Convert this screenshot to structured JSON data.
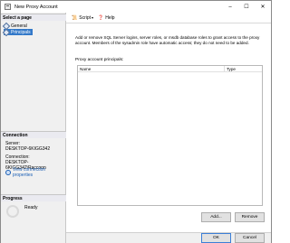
{
  "window": {
    "title": "New Proxy Account",
    "controls": [
      "–",
      "☐",
      "✕"
    ]
  },
  "left": {
    "select_page_header": "Select a page",
    "pages": [
      {
        "label": "General",
        "selected": false
      },
      {
        "label": "Principals",
        "selected": true
      }
    ],
    "connection_header": "Connection",
    "server_label": "Server:",
    "server_value": "DESKTOP-6KIGG342",
    "connection_label": "Connection:",
    "connection_value": "DESKTOP-6KIGG342\\Raccoon",
    "view_properties_link": "View connection properties",
    "progress_header": "Progress",
    "progress_status": "Ready"
  },
  "toolbar": {
    "script_label": "Script",
    "help_label": "Help"
  },
  "main": {
    "description": "Add or remove SQL Server logins, server roles, or msdb database roles to grant access to the proxy account. Members of the sysadmin role have automatic access; they do not need to be added.",
    "list_caption": "Proxy account principals:",
    "columns": {
      "name": "Name",
      "type": "Type"
    },
    "rows": [],
    "add_button": "Add...",
    "remove_button": "Remove"
  },
  "footer": {
    "ok_button": "OK",
    "cancel_button": "Cancel"
  },
  "colors": {
    "selection": "#3379c9",
    "link": "#1b5fb5"
  }
}
